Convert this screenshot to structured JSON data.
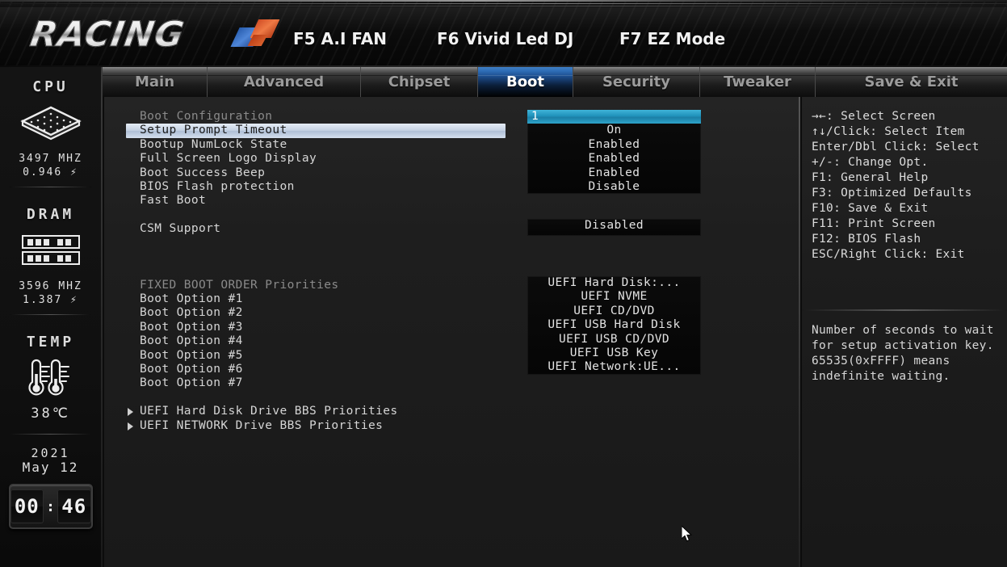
{
  "header": {
    "brand": "RACING",
    "function_keys": [
      {
        "name": "f5-ai-fan",
        "label": "F5 A.I FAN"
      },
      {
        "name": "f6-vivid-led",
        "label": "F6 Vivid Led DJ"
      },
      {
        "name": "f7-ez-mode",
        "label": "F7 EZ Mode"
      }
    ]
  },
  "tabs": [
    {
      "label": "Main",
      "active": false
    },
    {
      "label": "Advanced",
      "active": false
    },
    {
      "label": "Chipset",
      "active": false
    },
    {
      "label": "Boot",
      "active": true
    },
    {
      "label": "Security",
      "active": false
    },
    {
      "label": "Tweaker",
      "active": false
    },
    {
      "label": "Save & Exit",
      "active": false
    }
  ],
  "sidebar": {
    "cpu": {
      "title": "CPU",
      "freq": "3497 MHZ",
      "volt": "0.946 ⚡"
    },
    "dram": {
      "title": "DRAM",
      "freq": "3596 MHZ",
      "volt": "1.387 ⚡"
    },
    "temp": {
      "title": "TEMP",
      "value": "38℃"
    },
    "date": {
      "year": "2021",
      "monthday": "May  12"
    },
    "clock": {
      "hours": "00",
      "minutes": "46",
      "separator": ":"
    }
  },
  "main": {
    "section_boot_config": "Boot Configuration",
    "section_fixed_boot": "FIXED BOOT ORDER Priorities",
    "settings": [
      {
        "label": "Setup Prompt Timeout",
        "value": "1",
        "selected": true
      },
      {
        "label": "Bootup NumLock State",
        "value": "On",
        "selected": false
      },
      {
        "label": "Full Screen Logo Display",
        "value": "Enabled",
        "selected": false
      },
      {
        "label": "Boot Success Beep",
        "value": "Enabled",
        "selected": false
      },
      {
        "label": "BIOS Flash protection",
        "value": "Enabled",
        "selected": false
      },
      {
        "label": "Fast Boot",
        "value": "Disable",
        "selected": false
      }
    ],
    "csm": {
      "label": "CSM Support",
      "value": "Disabled"
    },
    "boot_options": [
      {
        "label": "Boot Option #1",
        "value": "UEFI Hard Disk:..."
      },
      {
        "label": "Boot Option #2",
        "value": "UEFI NVME"
      },
      {
        "label": "Boot Option #3",
        "value": "UEFI CD/DVD"
      },
      {
        "label": "Boot Option #4",
        "value": "UEFI USB Hard Disk"
      },
      {
        "label": "Boot Option #5",
        "value": "UEFI USB CD/DVD"
      },
      {
        "label": "Boot Option #6",
        "value": "UEFI USB Key"
      },
      {
        "label": "Boot Option #7",
        "value": "UEFI Network:UE..."
      }
    ],
    "submenus": [
      {
        "label": "UEFI Hard Disk Drive BBS Priorities"
      },
      {
        "label": "UEFI NETWORK Drive BBS Priorities"
      }
    ]
  },
  "right": {
    "keys": [
      "→←: Select Screen",
      "↑↓/Click: Select Item",
      "Enter/Dbl Click: Select",
      "+/-: Change Opt.",
      "F1: General Help",
      "F3: Optimized Defaults",
      "F10: Save & Exit",
      "F11: Print Screen",
      "F12: BIOS Flash",
      "ESC/Right Click: Exit"
    ],
    "help_text": "Number of seconds to wait for setup activation key. 65535(0xFFFF) means indefinite waiting."
  },
  "colors": {
    "accent_blue": "#2092bb",
    "tab_active": "#2f6fb8",
    "row_selected": "#c3d0e2",
    "text": "#d6d6d6",
    "section_text": "#8a8a8a"
  }
}
